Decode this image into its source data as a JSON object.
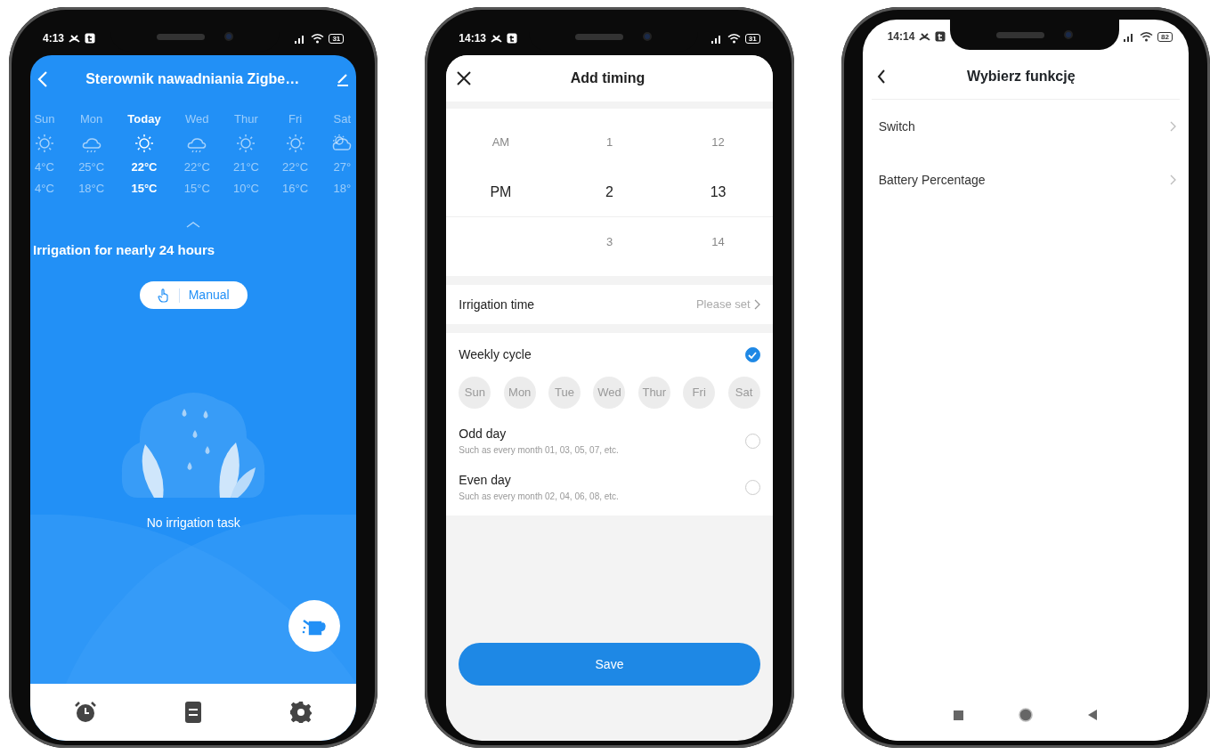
{
  "screen_1": {
    "status_bar": {
      "time": "4:13",
      "battery": "31"
    },
    "header": {
      "title": "Sterownik nawadniania Zigbe…"
    },
    "forecast": [
      {
        "day": "Sun",
        "kind": "sunny",
        "high": "4°C",
        "low": "4°C",
        "selected": false
      },
      {
        "day": "Mon",
        "kind": "rain",
        "high": "25°C",
        "low": "18°C",
        "selected": false
      },
      {
        "day": "Today",
        "kind": "sunny",
        "high": "22°C",
        "low": "15°C",
        "selected": true
      },
      {
        "day": "Wed",
        "kind": "rain",
        "high": "22°C",
        "low": "15°C",
        "selected": false
      },
      {
        "day": "Thur",
        "kind": "sunny",
        "high": "21°C",
        "low": "10°C",
        "selected": false
      },
      {
        "day": "Fri",
        "kind": "sunny",
        "high": "22°C",
        "low": "16°C",
        "selected": false
      },
      {
        "day": "Sat",
        "kind": "partly_cloudy",
        "high": "27°",
        "low": "18°",
        "selected": false
      }
    ],
    "summary": "Irrigation for nearly 24 hours",
    "manual_button": "Manual",
    "empty_message": "No irrigation task"
  },
  "screen_2": {
    "status_bar": {
      "time": "14:13",
      "battery": "31"
    },
    "header": {
      "title": "Add timing"
    },
    "time_picker": [
      {
        "items": [
          {
            "text": "AM",
            "selected": false
          },
          {
            "text": "PM",
            "selected": true
          }
        ]
      },
      {
        "items": [
          {
            "text": "1",
            "selected": false
          },
          {
            "text": "2",
            "selected": true
          },
          {
            "text": "3",
            "selected": false
          }
        ]
      },
      {
        "items": [
          {
            "text": "12",
            "selected": false
          },
          {
            "text": "13",
            "selected": true
          },
          {
            "text": "14",
            "selected": false
          }
        ]
      }
    ],
    "irrigation_time": {
      "label": "Irrigation time",
      "value": "Please set"
    },
    "cycles": [
      {
        "label": "Weekly cycle",
        "selected": true,
        "days": [
          {
            "label": "Sun",
            "selected": false
          },
          {
            "label": "Mon",
            "selected": false
          },
          {
            "label": "Tue",
            "selected": false
          },
          {
            "label": "Wed",
            "selected": false
          },
          {
            "label": "Thur",
            "selected": false
          },
          {
            "label": "Fri",
            "selected": false
          },
          {
            "label": "Sat",
            "selected": false
          }
        ]
      },
      {
        "label": "Odd day",
        "hint": "Such as every month 01, 03, 05, 07, etc.",
        "selected": false
      },
      {
        "label": "Even day",
        "hint": "Such as every month 02, 04, 06, 08, etc.",
        "selected": false
      }
    ],
    "save_button": "Save"
  },
  "screen_3": {
    "status_bar": {
      "time": "14:14",
      "battery": "82"
    },
    "header": {
      "title": "Wybierz funkcję"
    },
    "functions": [
      {
        "label": "Switch"
      },
      {
        "label": "Battery Percentage"
      }
    ]
  }
}
